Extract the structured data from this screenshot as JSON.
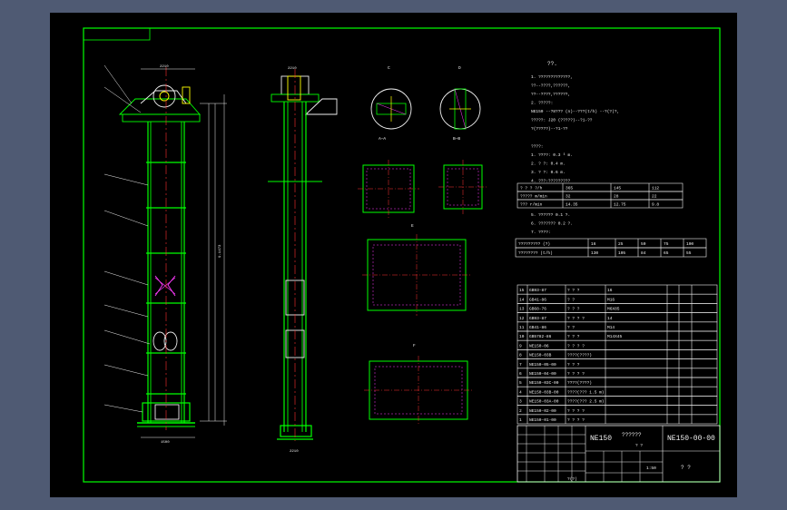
{
  "labels": {
    "top_dim_1": "2210",
    "top_dim_2": "2210",
    "total_height": "9-1473",
    "pulley_dim": "1400",
    "bottom_dim": "1500",
    "side_bottom": "2210",
    "side_label": "11"
  },
  "sections": {
    "a_label": "A—A",
    "b_label": "B—B",
    "c_label": "C",
    "d_label": "D",
    "e_label": "E",
    "f_label": "F",
    "g_label": "G"
  },
  "notes": {
    "title": "??.",
    "lines": [
      "1. ?????????????,",
      "   ??--????,??????,",
      "   ??--????,??????,",
      "2. ?????:",
      "   NE150    --?8???    (n)--???(t/h)    --?(?)?,",
      "   ?????: J20    (?????)--?1-??",
      "                  ?(?????)--?1-??",
      "   ????:",
      "1. ????:  0.3  ³  m.",
      "2. ?  ?:  0.4       m.",
      "3. ?  ?:  0.6       m.",
      "4. ???:?????????",
      "5. ??????  0.1   ?.",
      "6. ???????  0.2   ?.",
      "7. ????:"
    ]
  },
  "table1": {
    "rows": [
      [
        "? ? ?   ?/h",
        "365",
        "145",
        "112"
      ],
      [
        "????? m/min",
        "32",
        "28",
        "22"
      ],
      [
        "???   r/min",
        "14.35",
        "12.75",
        "9.8"
      ]
    ]
  },
  "table2": {
    "rows": [
      [
        "????????? (?)",
        "16",
        "25",
        "50",
        "75",
        "100"
      ],
      [
        "???????? (t/h)",
        "130",
        "105",
        "84",
        "65",
        "55"
      ]
    ]
  },
  "bom": [
    [
      "15",
      "GB93-87",
      "? ? ?",
      "16"
    ],
    [
      "14",
      "GB41-86",
      "? ?",
      "M16"
    ],
    [
      "13",
      "GB68-76",
      "? ? ?",
      "M6X85"
    ],
    [
      "12",
      "GB93-87",
      "? ? ? ?",
      "14"
    ],
    [
      "11",
      "GB41-86",
      "? ?",
      "M14"
    ],
    [
      "10",
      "GB5782-86",
      "? ? ?",
      "M14X45"
    ],
    [
      "9",
      "NE150-06",
      "? ? ? ?",
      ""
    ],
    [
      "8",
      "NE150-03B",
      "????(????)",
      ""
    ],
    [
      "7",
      "NE150-05-00",
      "? ? ?",
      ""
    ],
    [
      "6",
      "NE150-04-00",
      "? ? ? ?",
      ""
    ],
    [
      "5",
      "NE150-03C-00",
      "????(????)",
      ""
    ],
    [
      "4",
      "NE150-03B-00",
      "????(??? 1.5 m)",
      ""
    ],
    [
      "3",
      "NE150-03A-00",
      "????(??? 2.5 m)",
      ""
    ],
    [
      "2",
      "NE150-02-00",
      "? ? ? ?",
      ""
    ],
    [
      "1",
      "NE150-01-00",
      "? ? ? ?",
      ""
    ]
  ],
  "title_block": {
    "model": "NE150",
    "drawing_no": "NE150-00-00",
    "name": "??????",
    "sub": "? ?",
    "scale": "1:50",
    "sheet": "? ?",
    "sign": "?(?)"
  }
}
